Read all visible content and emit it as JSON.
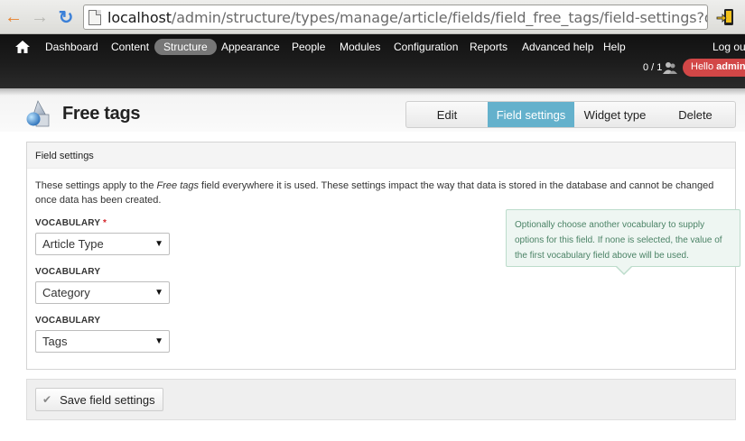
{
  "browser": {
    "url_host": "localhost",
    "url_path": "/admin/structure/types/manage/article/fields/field_free_tags/field-settings?destinations"
  },
  "toolbar": {
    "menu": [
      {
        "label": "Dashboard"
      },
      {
        "label": "Content"
      },
      {
        "label": "Structure",
        "active": true
      },
      {
        "label": "Appearance"
      },
      {
        "label": "People"
      },
      {
        "label": "Modules"
      },
      {
        "label": "Configuration"
      },
      {
        "label": "Reports"
      },
      {
        "label": "Advanced help"
      },
      {
        "label": "Help"
      }
    ],
    "logout": "Log out",
    "user_count": "0 / 1",
    "hello_prefix": "Hello",
    "hello_user": "admin",
    "accent": "#d24747"
  },
  "header": {
    "title": "Free tags",
    "tabs": [
      {
        "label": "Edit"
      },
      {
        "label": "Field settings",
        "active": true
      },
      {
        "label": "Widget type"
      },
      {
        "label": "Delete"
      }
    ],
    "active_tab_color": "#64b1cc"
  },
  "fieldset": {
    "legend": "Field settings",
    "description_before": "These settings apply to the ",
    "description_em": "Free tags",
    "description_after": " field everywhere it is used. These settings impact the way that data is stored in the database and cannot be changed once data has been created.",
    "vocabularies": [
      {
        "label": "VOCABULARY",
        "required": "*",
        "value": "Article Type"
      },
      {
        "label": "VOCABULARY",
        "value": "Category"
      },
      {
        "label": "VOCABULARY",
        "value": "Tags"
      }
    ],
    "tooltip": "Optionally choose another vocabulary to supply options for this field. If none is selected, the value of the first vocabulary field above will be used."
  },
  "actions": {
    "save_label": "Save field settings"
  }
}
